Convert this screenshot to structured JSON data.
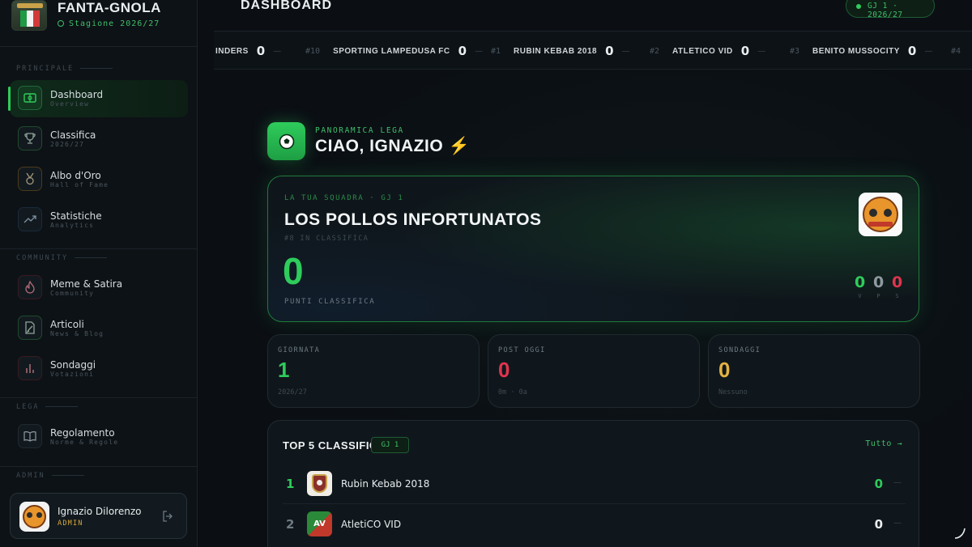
{
  "brand": {
    "title": "FANTA-GNOLA",
    "season": "Stagione 2026/27"
  },
  "sidebar": {
    "sections": {
      "principale": "PRINCIPALE",
      "community": "COMMUNITY",
      "lega": "LEGA",
      "admin": "ADMIN"
    },
    "items": [
      {
        "label": "Dashboard",
        "sub": "Overview",
        "icon": "pitch-icon",
        "active": true
      },
      {
        "label": "Classifica",
        "sub": "2026/27",
        "icon": "trophy-icon"
      },
      {
        "label": "Albo d'Oro",
        "sub": "Hall of Fame",
        "icon": "medal-icon"
      },
      {
        "label": "Statistiche",
        "sub": "Analytics",
        "icon": "trend-icon"
      },
      {
        "label": "Meme & Satira",
        "sub": "Community",
        "icon": "flame-icon"
      },
      {
        "label": "Articoli",
        "sub": "News & Blog",
        "icon": "pen-icon"
      },
      {
        "label": "Sondaggi",
        "sub": "Votazioni",
        "icon": "bars-icon"
      },
      {
        "label": "Regolamento",
        "sub": "Norme & Regole",
        "icon": "book-icon"
      }
    ],
    "user": {
      "name": "Ignazio Dilorenzo",
      "role": "ADMIN"
    }
  },
  "header": {
    "title": "DASHBOARD",
    "season_pill": "GJ 1 · 2026/27"
  },
  "ticker": [
    {
      "rank": "",
      "name": "INDERS",
      "points": "0",
      "dash": "—"
    },
    {
      "rank": "#10",
      "name": "SPORTING LAMPEDUSA FC",
      "points": "0",
      "dash": "—"
    },
    {
      "rank": "#1",
      "name": "RUBIN KEBAB 2018",
      "points": "0",
      "dash": "—"
    },
    {
      "rank": "#2",
      "name": "ATLETICO VID",
      "points": "0",
      "dash": "—"
    },
    {
      "rank": "#3",
      "name": "BENITO MUSSOCITY",
      "points": "0",
      "dash": "—"
    },
    {
      "rank": "#4",
      "name": "",
      "points": "",
      "dash": ""
    }
  ],
  "overview": {
    "eyebrow": "PANORAMICA LEGA",
    "greeting": "CIAO, IGNAZIO ⚡"
  },
  "team": {
    "eyebrow": "LA TUA SQUADRA · GJ 1",
    "name": "LOS POLLOS INFORTUNATOS",
    "rank": "#8 IN CLASSIFICA",
    "points": "0",
    "points_label": "PUNTI CLASSIFICA",
    "v": "0",
    "p": "0",
    "s": "0",
    "v_label": "V",
    "p_label": "P",
    "s_label": "S"
  },
  "stats": [
    {
      "label": "GIORNATA",
      "value": "1",
      "sub": "2026/27",
      "color": "#2ecc5b"
    },
    {
      "label": "POST OGGI",
      "value": "0",
      "sub": "0m · 0a",
      "color": "#e0344e"
    },
    {
      "label": "SONDAGGI",
      "value": "0",
      "sub": "Nessuno",
      "color": "#e3b341"
    }
  ],
  "top5": {
    "title": "TOP 5 CLASSIFICA",
    "pill": "GJ 1",
    "all_link": "Tutto →",
    "rows": [
      {
        "rank": "1",
        "name": "Rubin Kebab 2018",
        "points": "0",
        "dash": "—"
      },
      {
        "rank": "2",
        "name": "AtletiCO VID",
        "points": "0",
        "dash": "—",
        "logo_text": "AV"
      }
    ]
  },
  "colors": {
    "accent": "#2ecc5b",
    "danger": "#e0344e",
    "warning": "#e3b341",
    "gold": "#d9a83a"
  }
}
